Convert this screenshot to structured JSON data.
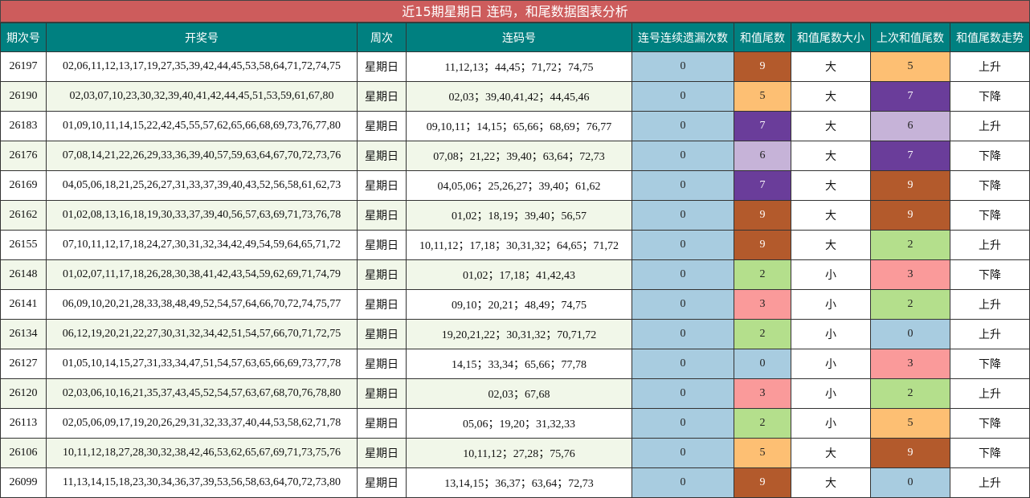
{
  "title": "近15期星期日 连码，和尾数据图表分析",
  "headers": [
    "期次号",
    "开奖号",
    "周次",
    "连码号",
    "连号连续遗漏次数",
    "和值尾数",
    "和值尾数大小",
    "上次和值尾数",
    "和值尾数走势"
  ],
  "colors": {
    "title_bg": "#cd5c5c",
    "header_bg": "#008080",
    "miss_bg": "#a8cce0",
    "alt_row_bg": "#f1f7e9",
    "tail": {
      "0": "#a8cce0",
      "2": "#b4df8c",
      "3": "#fa9a9a",
      "5": "#fdbf73",
      "6": "#c6b3d8",
      "7": "#6a3d9a",
      "9": "#b35a2c"
    }
  },
  "rows": [
    {
      "period": "26197",
      "numbers": "02,06,11,12,13,17,19,27,35,39,42,44,45,53,58,64,71,72,74,75",
      "weekday": "星期日",
      "consecutive": "11,12,13；44,45；71,72；74,75",
      "miss": "0",
      "tail": "9",
      "size": "大",
      "prev_tail": "5",
      "trend": "上升"
    },
    {
      "period": "26190",
      "numbers": "02,03,07,10,23,30,32,39,40,41,42,44,45,51,53,59,61,67,80",
      "weekday": "星期日",
      "consecutive": "02,03；39,40,41,42；44,45,46",
      "miss": "0",
      "tail": "5",
      "size": "大",
      "prev_tail": "7",
      "trend": "下降"
    },
    {
      "period": "26183",
      "numbers": "01,09,10,11,14,15,22,42,45,55,57,62,65,66,68,69,73,76,77,80",
      "weekday": "星期日",
      "consecutive": "09,10,11；14,15；65,66；68,69；76,77",
      "miss": "0",
      "tail": "7",
      "size": "大",
      "prev_tail": "6",
      "trend": "上升"
    },
    {
      "period": "26176",
      "numbers": "07,08,14,21,22,26,29,33,36,39,40,57,59,63,64,67,70,72,73,76",
      "weekday": "星期日",
      "consecutive": "07,08；21,22；39,40；63,64；72,73",
      "miss": "0",
      "tail": "6",
      "size": "大",
      "prev_tail": "7",
      "trend": "下降"
    },
    {
      "period": "26169",
      "numbers": "04,05,06,18,21,25,26,27,31,33,37,39,40,43,52,56,58,61,62,73",
      "weekday": "星期日",
      "consecutive": "04,05,06；25,26,27；39,40；61,62",
      "miss": "0",
      "tail": "7",
      "size": "大",
      "prev_tail": "9",
      "trend": "下降"
    },
    {
      "period": "26162",
      "numbers": "01,02,08,13,16,18,19,30,33,37,39,40,56,57,63,69,71,73,76,78",
      "weekday": "星期日",
      "consecutive": "01,02；18,19；39,40；56,57",
      "miss": "0",
      "tail": "9",
      "size": "大",
      "prev_tail": "9",
      "trend": "下降"
    },
    {
      "period": "26155",
      "numbers": "07,10,11,12,17,18,24,27,30,31,32,34,42,49,54,59,64,65,71,72",
      "weekday": "星期日",
      "consecutive": "10,11,12；17,18；30,31,32；64,65；71,72",
      "miss": "0",
      "tail": "9",
      "size": "大",
      "prev_tail": "2",
      "trend": "上升"
    },
    {
      "period": "26148",
      "numbers": "01,02,07,11,17,18,26,28,30,38,41,42,43,54,59,62,69,71,74,79",
      "weekday": "星期日",
      "consecutive": "01,02；17,18；41,42,43",
      "miss": "0",
      "tail": "2",
      "size": "小",
      "prev_tail": "3",
      "trend": "下降"
    },
    {
      "period": "26141",
      "numbers": "06,09,10,20,21,28,33,38,48,49,52,54,57,64,66,70,72,74,75,77",
      "weekday": "星期日",
      "consecutive": "09,10；20,21；48,49；74,75",
      "miss": "0",
      "tail": "3",
      "size": "小",
      "prev_tail": "2",
      "trend": "上升"
    },
    {
      "period": "26134",
      "numbers": "06,12,19,20,21,22,27,30,31,32,34,42,51,54,57,66,70,71,72,75",
      "weekday": "星期日",
      "consecutive": "19,20,21,22；30,31,32；70,71,72",
      "miss": "0",
      "tail": "2",
      "size": "小",
      "prev_tail": "0",
      "trend": "上升"
    },
    {
      "period": "26127",
      "numbers": "01,05,10,14,15,27,31,33,34,47,51,54,57,63,65,66,69,73,77,78",
      "weekday": "星期日",
      "consecutive": "14,15；33,34；65,66；77,78",
      "miss": "0",
      "tail": "0",
      "size": "小",
      "prev_tail": "3",
      "trend": "下降"
    },
    {
      "period": "26120",
      "numbers": "02,03,06,10,16,21,35,37,43,45,52,54,57,63,67,68,70,76,78,80",
      "weekday": "星期日",
      "consecutive": "02,03；67,68",
      "miss": "0",
      "tail": "3",
      "size": "小",
      "prev_tail": "2",
      "trend": "上升"
    },
    {
      "period": "26113",
      "numbers": "02,05,06,09,17,19,20,26,29,31,32,33,37,40,44,53,58,62,71,78",
      "weekday": "星期日",
      "consecutive": "05,06；19,20；31,32,33",
      "miss": "0",
      "tail": "2",
      "size": "小",
      "prev_tail": "5",
      "trend": "下降"
    },
    {
      "period": "26106",
      "numbers": "10,11,12,18,27,28,30,32,38,42,46,53,62,65,67,69,71,73,75,76",
      "weekday": "星期日",
      "consecutive": "10,11,12；27,28；75,76",
      "miss": "0",
      "tail": "5",
      "size": "大",
      "prev_tail": "9",
      "trend": "下降"
    },
    {
      "period": "26099",
      "numbers": "11,13,14,15,18,23,30,34,36,37,39,53,56,58,63,64,70,72,73,80",
      "weekday": "星期日",
      "consecutive": "13,14,15；36,37；63,64；72,73",
      "miss": "0",
      "tail": "9",
      "size": "大",
      "prev_tail": "0",
      "trend": "上升"
    }
  ]
}
